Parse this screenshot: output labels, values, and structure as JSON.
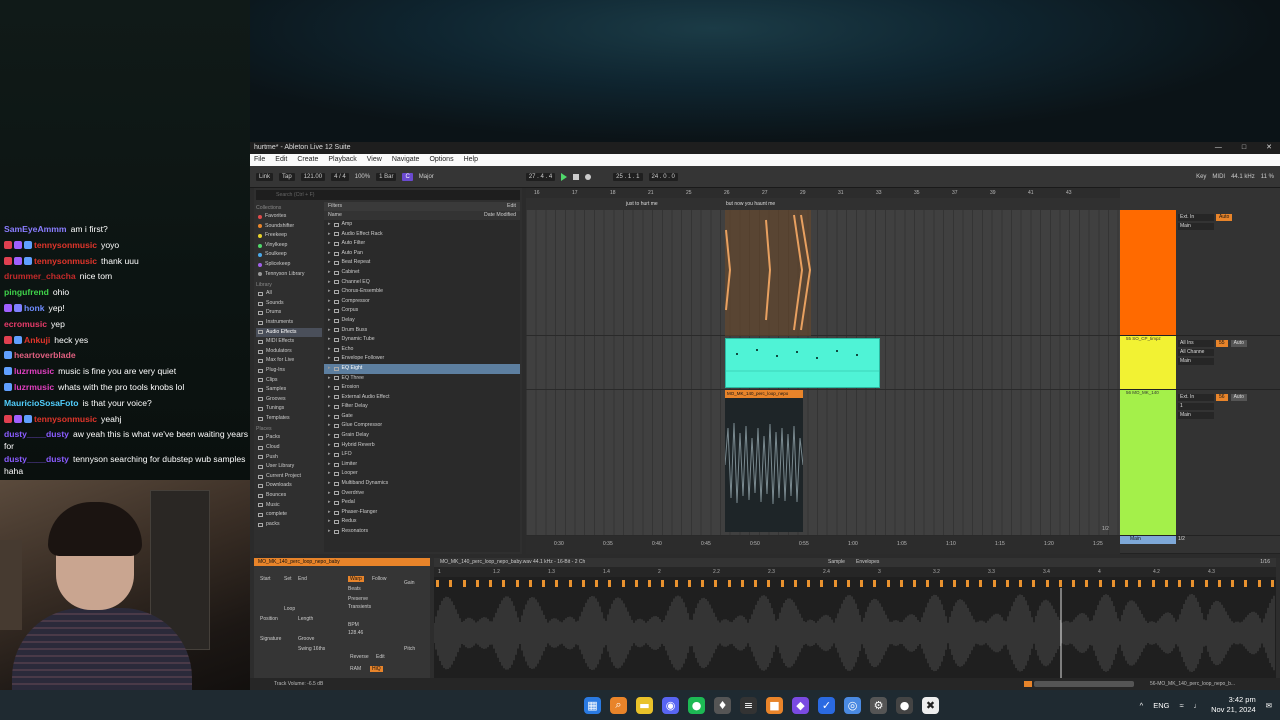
{
  "chat": [
    {
      "user": "SamEyeAmmm",
      "user_color": "#8a7dff",
      "text": "am i first?",
      "badges": []
    },
    {
      "user": "tennysonmusic",
      "user_color": "#e0352b",
      "text": "yoyo",
      "badges": [
        "#e04050",
        "#a060ff",
        "#60a0ff"
      ]
    },
    {
      "user": "tennysonmusic",
      "user_color": "#e0352b",
      "text": "thank uuu",
      "badges": [
        "#e04050",
        "#a060ff",
        "#60a0ff"
      ]
    },
    {
      "user": "drummer_chacha",
      "user_color": "#c42a2a",
      "text": "nice tom",
      "badges": []
    },
    {
      "user": "pingufrend",
      "user_color": "#3fd24a",
      "text": "ohio",
      "badges": []
    },
    {
      "user": "honk",
      "user_color": "#6f8cff",
      "text": "yep!",
      "badges": [
        "#a060ff",
        "#8080ff"
      ]
    },
    {
      "user": "ecromusic",
      "user_color": "#e93b6a",
      "text": "yep",
      "badges": []
    },
    {
      "user": "Ankuji",
      "user_color": "#e0352b",
      "text": "heck yes",
      "badges": [
        "#e04050",
        "#60a0ff"
      ]
    },
    {
      "user": "heartoverblade",
      "user_color": "#e06080",
      "text": "",
      "badges": [
        "#60a0ff"
      ]
    },
    {
      "user": "luzrmusic",
      "user_color": "#e040c0",
      "text": "music is fine you are very quiet",
      "badges": [
        "#60a0ff"
      ]
    },
    {
      "user": "luzrmusic",
      "user_color": "#e040c0",
      "text": "whats with the pro tools knobs lol",
      "badges": [
        "#60a0ff"
      ]
    },
    {
      "user": "MauricioSosaFoto",
      "user_color": "#52d0ff",
      "text": "is that your voice?",
      "badges": []
    },
    {
      "user": "tennysonmusic",
      "user_color": "#e0352b",
      "text": "yeahj",
      "badges": [
        "#e04050",
        "#a060ff",
        "#60a0ff"
      ]
    },
    {
      "user": "dusty____dusty",
      "user_color": "#8a5cff",
      "text": "aw yeah this is what we've been waiting years for",
      "badges": []
    },
    {
      "user": "dusty____dusty",
      "user_color": "#8a5cff",
      "text": "tennyson searching for dubstep wub samples haha",
      "badges": []
    }
  ],
  "window": {
    "title": "hurtme* - Ableton Live 12 Suite",
    "controls": [
      "—",
      "□",
      "✕"
    ]
  },
  "menu": [
    "File",
    "Edit",
    "Create",
    "Playback",
    "View",
    "Navigate",
    "Options",
    "Help"
  ],
  "control_bar": {
    "link": "Link",
    "tap": "Tap",
    "tempo": "121.00",
    "signature": "4 / 4",
    "zoom": "100%",
    "quantize": "1 Bar",
    "key": "C",
    "scale": "Major",
    "position": "27 .  4 .  4",
    "loop_start": "25 .  1 .  1",
    "loop_len": "24 .  0 .  0",
    "key_label": "Key",
    "midi_label": "MIDI",
    "sample_rate": "44.1 kHz",
    "cpu": "11 %"
  },
  "browser": {
    "search_placeholder": "Search (Ctrl + F)",
    "collections_label": "Collections",
    "collections": [
      {
        "label": "Favorites",
        "color": "#e04a4a"
      },
      {
        "label": "Soundshifter",
        "color": "#e8842a"
      },
      {
        "label": "Freekeep",
        "color": "#e8d22a"
      },
      {
        "label": "Vinylkeep",
        "color": "#4fd86a"
      },
      {
        "label": "Soulkeep",
        "color": "#4aa8e8"
      },
      {
        "label": "Splicekeep",
        "color": "#a060e8"
      },
      {
        "label": "Tennyson Library",
        "color": "#999999"
      }
    ],
    "library_label": "Library",
    "library": [
      "All",
      "Sounds",
      "Drums",
      "Instruments",
      "Audio Effects",
      "MIDI Effects",
      "Modulators",
      "Max for Live",
      "Plug-Ins",
      "Clips",
      "Samples",
      "Grooves",
      "Tunings",
      "Templates"
    ],
    "places_label": "Places",
    "places": [
      "Packs",
      "Cloud",
      "Push",
      "User Library",
      "Current Project",
      "Downloads",
      "Bounces",
      "Music",
      "complete",
      "packs"
    ],
    "filters_label": "Filters",
    "edit_label": "Edit",
    "name_header": "Name",
    "date_header": "Date Modified",
    "items": [
      "Amp",
      "Audio Effect Rack",
      "Auto Filter",
      "Auto Pan",
      "Beat Repeat",
      "Cabinet",
      "Channel EQ",
      "Chorus-Ensemble",
      "Compressor",
      "Corpus",
      "Delay",
      "Drum Buss",
      "Dynamic Tube",
      "Echo",
      "Envelope Follower",
      "EQ Eight",
      "EQ Three",
      "Erosion",
      "External Audio Effect",
      "Filter Delay",
      "Gate",
      "Glue Compressor",
      "Grain Delay",
      "Hybrid Reverb",
      "LFO",
      "Limiter",
      "Looper",
      "Multiband Dynamics",
      "Overdrive",
      "Pedal",
      "Phaser-Flanger",
      "Redux",
      "Resonators"
    ]
  },
  "arrangement": {
    "ruler": [
      "16",
      "17",
      "18",
      "21",
      "25",
      "26",
      "27",
      "29",
      "31",
      "33",
      "35",
      "37",
      "39",
      "41",
      "43"
    ],
    "locators": [
      "just to hurt me",
      "but now you haunt me"
    ],
    "timeline": [
      "0:30",
      "0:35",
      "0:40",
      "0:45",
      "0:50",
      "0:55",
      "1:00",
      "1:05",
      "1:10",
      "1:15",
      "1:20",
      "1:25"
    ],
    "page": "1/2",
    "clip_label": "MO_MK_140_perc_loop_nepo"
  },
  "mixer": [
    {
      "name": "",
      "color": "#ff6a00",
      "input": "Ext. In",
      "monitor": "Auto",
      "output": "Main"
    },
    {
      "name": "55 SO_CP_timpz",
      "color": "#f2f233",
      "input": "All Ins",
      "channel": "All Channe",
      "monitor": "Auto",
      "output": "Main",
      "vol": "55"
    },
    {
      "name": "56 MO_MK_140",
      "color": "#a4f04a",
      "input": "Ext. In",
      "channel": "1",
      "monitor": "Auto",
      "output": "Main",
      "vol": "56"
    }
  ],
  "master": {
    "label": "Main",
    "out": "1/2"
  },
  "detail": {
    "clip_name": "MO_MK_140_perc_loop_nepo_baby",
    "file_info": "MO_MK_140_perc_loop_nepo_baby.wav  44.1 kHz - 16-Bit - 2 Ch",
    "tabs": [
      "Sample",
      "Envelopes"
    ],
    "page": "1/16",
    "start": "Start",
    "end": "End",
    "set": "Set",
    "warp": "Warp",
    "follow": "Follow",
    "mode": "Beats",
    "preserve": "Preserve",
    "transients": "Transients",
    "loop": "Loop",
    "position": "Position",
    "length": "Length",
    "signature": "Signature",
    "groove": "Groove",
    "swing": "Swing 16ths",
    "bpm_label": "BPM",
    "bpm": "128.46",
    "reverse": "Reverse",
    "edit": "Edit",
    "ram": "RAM",
    "hiq": "HiQ",
    "gain": "Gain",
    "pitch": "Pitch",
    "ruler": [
      "1",
      "1.2",
      "1.3",
      "1.4",
      "2",
      "2.2",
      "2.3",
      "2.4",
      "3",
      "3.2",
      "3.3",
      "3.4",
      "4",
      "4.2",
      "4.3"
    ]
  },
  "status": {
    "left": "Track Volume: -6.5 dB",
    "right": "56-MO_MK_140_perc_loop_nepo_b..."
  },
  "taskbar": {
    "icons": [
      {
        "name": "windows-start-icon",
        "glyph": "▦",
        "bg": "#2a7ae2"
      },
      {
        "name": "search-icon",
        "glyph": "⌕",
        "bg": "#e8842a"
      },
      {
        "name": "file-explorer-icon",
        "glyph": "▬",
        "bg": "#e8c22a"
      },
      {
        "name": "discord-icon",
        "glyph": "◉",
        "bg": "#5865f2"
      },
      {
        "name": "spotify-icon",
        "glyph": "●",
        "bg": "#1db954"
      },
      {
        "name": "app-icon",
        "glyph": "♦",
        "bg": "#555555"
      },
      {
        "name": "ableton-icon",
        "glyph": "≡",
        "bg": "#333333"
      },
      {
        "name": "app-orange-icon",
        "glyph": "■",
        "bg": "#e8842a"
      },
      {
        "name": "app-purple-icon",
        "glyph": "◆",
        "bg": "#7a4ae2"
      },
      {
        "name": "app-blue-icon",
        "glyph": "✓",
        "bg": "#2a6ae2"
      },
      {
        "name": "chrome-icon",
        "glyph": "◎",
        "bg": "#4a8ae2"
      },
      {
        "name": "settings-icon",
        "glyph": "⚙",
        "bg": "#555555"
      },
      {
        "name": "obs-icon",
        "glyph": "●",
        "bg": "#444444"
      },
      {
        "name": "app-white-icon",
        "glyph": "✖",
        "bg": "#eeeeee"
      }
    ],
    "lang": "ENG",
    "time": "3:42 pm",
    "date": "Nov 21, 2024"
  }
}
